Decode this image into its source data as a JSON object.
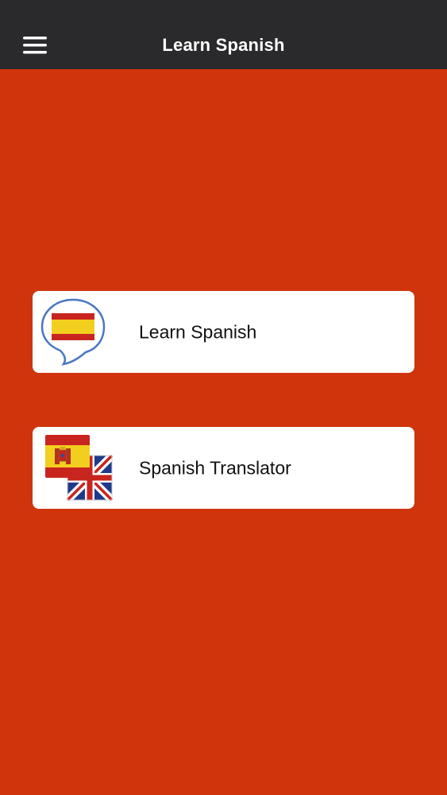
{
  "app_bar": {
    "title": "Learn Spanish",
    "menu_icon": "hamburger-menu-icon"
  },
  "menu": [
    {
      "id": "learn",
      "label": "Learn Spanish",
      "icon": "spanish-flag-speech-bubble-icon"
    },
    {
      "id": "translate",
      "label": "Spanish Translator",
      "icon": "spanish-uk-flags-icon"
    }
  ],
  "colors": {
    "app_bar_bg": "#2a2a2c",
    "background": "#cf340c",
    "card_bg": "#ffffff",
    "spain_red": "#c8251f",
    "spain_yellow": "#f2cf1f",
    "uk_blue": "#1f3a8a",
    "bubble_outline": "#4a78c2"
  }
}
